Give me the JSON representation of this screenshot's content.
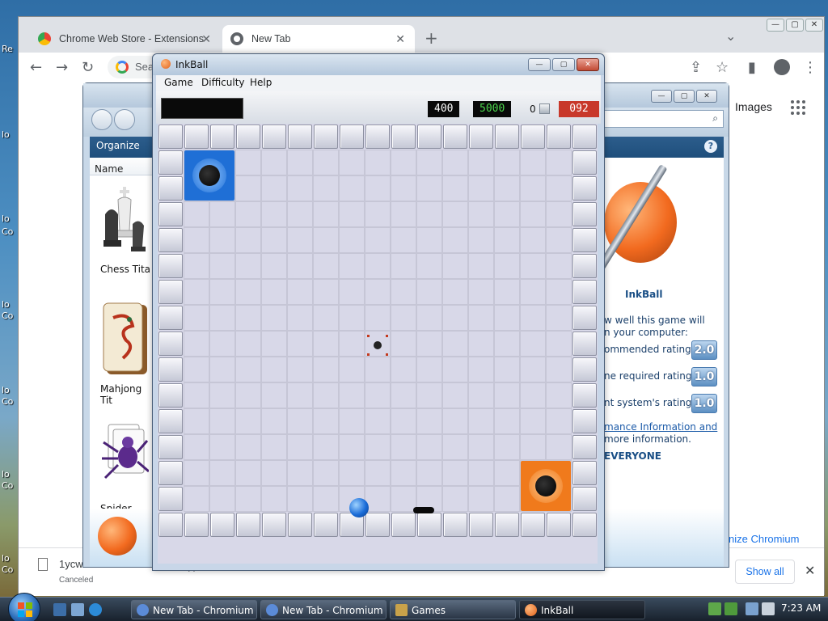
{
  "desktop": {
    "labels": [
      "Re",
      "lo",
      "lo",
      "lo",
      "lo",
      "lo",
      "lo",
      "lo",
      "Co",
      "Co",
      "Co",
      "Co",
      "Co",
      "Co"
    ]
  },
  "chrome": {
    "tabs": [
      {
        "label": "Chrome Web Store - Extensions",
        "close": "✕"
      },
      {
        "label": "New Tab",
        "close": "✕"
      }
    ],
    "new_tab": "+",
    "tab_list": "⌄",
    "window_controls": [
      "—",
      "▢",
      "✕"
    ],
    "toolbar": {
      "back": "←",
      "forward": "→",
      "reload": "↻",
      "omnibox_placeholder": "Sea",
      "share": "⇪",
      "bookmark": "☆",
      "sidebar": "▮",
      "menu": "⋮"
    },
    "content": {
      "images_link": "Images",
      "customize_button": "nize Chromium"
    },
    "downloads": {
      "filename": "1ycw",
      "status": "Canceled",
      "dismiss": "✕",
      "show_all": "Show all",
      "close": "✕"
    }
  },
  "games_explorer": {
    "window_controls": [
      "—",
      "▢",
      "✕"
    ],
    "search_icon": "⌕",
    "organize_label": "Organize",
    "help": "?",
    "column_name": "Name",
    "games": [
      {
        "name": "Chess Tita"
      },
      {
        "name": "Mahjong Tit"
      },
      {
        "name": "Spider Solit"
      }
    ],
    "details": {
      "title": "InkBall",
      "perf_line1": "w well this game will",
      "perf_line2": "n your computer:",
      "recommended_label": "ommended rating:",
      "recommended_value": "2.0",
      "required_label": "ne required rating:",
      "required_value": "1.0",
      "system_label": "nt system's rating:",
      "system_value": "1.0",
      "perf_link": "mance Information and",
      "more_info": "more information.",
      "esrb": "EVERYONE"
    }
  },
  "inkball": {
    "title": "InkBall",
    "window_controls": [
      "—",
      "▢",
      "✕"
    ],
    "menu": [
      "Game",
      "Difficulty",
      "Help"
    ],
    "scores": [
      {
        "value": "400",
        "color": "#ffffff"
      },
      {
        "value": "5000",
        "color": "#4cd64c"
      }
    ],
    "balls_left": "0",
    "time": "092",
    "colors": {
      "blue_hole": "#1f6fd6",
      "orange_hole": "#f07a1c",
      "ball": "#1a6cd8",
      "timer": "#c8382a"
    }
  },
  "taskbar": {
    "tasks": [
      {
        "label": "New Tab - Chromium"
      },
      {
        "label": "New Tab - Chromium"
      },
      {
        "label": "Games"
      },
      {
        "label": "InkBall"
      }
    ],
    "clock": "7:23 AM"
  }
}
